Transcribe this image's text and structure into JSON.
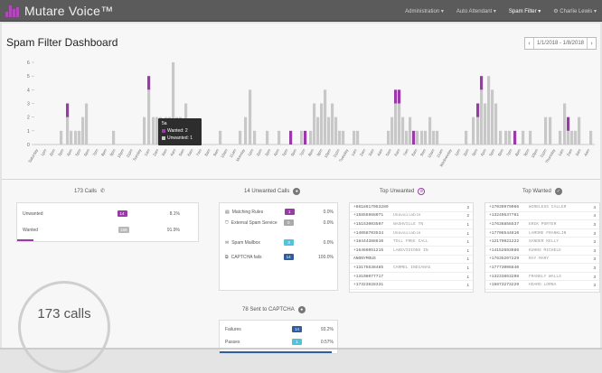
{
  "app": {
    "name": "Mutare Voice™"
  },
  "nav": [
    {
      "label": "Administration ▾",
      "active": false
    },
    {
      "label": "Auto Attendant ▾",
      "active": false
    },
    {
      "label": "Spam Filter ▾",
      "active": true
    },
    {
      "label": "⚙ Charlie Lewis ▾",
      "active": false
    }
  ],
  "page": {
    "title": "Spam Filter Dashboard"
  },
  "date_picker": {
    "prev": "‹",
    "label": "1/1/2018 - 1/8/2018",
    "next": "›"
  },
  "colors": {
    "accent": "#9a3aa8",
    "bar_gray": "#c8c8c8",
    "blue": "#2f5d9e",
    "cyan": "#53c3dc",
    "topbar": "#5b5b5b"
  },
  "chart_data": {
    "type": "bar",
    "stacked": true,
    "series": [
      {
        "name": "Wanted",
        "color": "#c8c8c8"
      },
      {
        "name": "Unwanted",
        "color": "#9a3aa8"
      }
    ],
    "y_ticks": [
      "0",
      "1",
      "2",
      "3",
      "4",
      "5",
      "6"
    ],
    "ylim": [
      0,
      6.2
    ],
    "x_tick_labels": [
      "Saturday",
      "1pm",
      "2pm",
      "3pm",
      "4pm",
      "5pm",
      "6pm",
      "7pm",
      "8pm",
      "9pm",
      "10pm",
      "11pm",
      "Sunday",
      "1am",
      "2am",
      "3am",
      "4am",
      "5am",
      "6am",
      "7am",
      "8am",
      "9am",
      "10am",
      "11am",
      "Monday",
      "1pm",
      "2pm",
      "3pm",
      "4pm",
      "5pm",
      "6pm",
      "7pm",
      "8pm",
      "9pm",
      "10pm",
      "11pm",
      "Tuesday",
      "1am",
      "2am",
      "3am",
      "4am",
      "5am",
      "6am",
      "7am",
      "8am",
      "9am",
      "10am",
      "11am",
      "Wednesday",
      "1pm",
      "2pm",
      "3pm",
      "4pm",
      "5pm",
      "6pm",
      "7pm",
      "8pm",
      "9pm",
      "10pm",
      "11pm",
      "Thursday",
      "1am",
      "2am",
      "3am",
      "4am"
    ],
    "bars": [
      {
        "x": 64,
        "wanted": 1,
        "unwanted": 0
      },
      {
        "x": 71,
        "wanted": 2,
        "unwanted": 1
      },
      {
        "x": 75,
        "wanted": 1,
        "unwanted": 0
      },
      {
        "x": 80,
        "wanted": 1,
        "unwanted": 0
      },
      {
        "x": 84,
        "wanted": 1,
        "unwanted": 0
      },
      {
        "x": 88,
        "wanted": 2,
        "unwanted": 0
      },
      {
        "x": 92,
        "wanted": 3,
        "unwanted": 0
      },
      {
        "x": 122,
        "wanted": 1,
        "unwanted": 0
      },
      {
        "x": 156,
        "wanted": 2,
        "unwanted": 0
      },
      {
        "x": 161,
        "wanted": 4,
        "unwanted": 1
      },
      {
        "x": 166,
        "wanted": 2,
        "unwanted": 0
      },
      {
        "x": 170,
        "wanted": 2,
        "unwanted": 0
      },
      {
        "x": 174,
        "wanted": 2,
        "unwanted": 0
      },
      {
        "x": 180,
        "wanted": 2,
        "unwanted": 0
      },
      {
        "x": 184,
        "wanted": 2,
        "unwanted": 0
      },
      {
        "x": 188,
        "wanted": 6,
        "unwanted": 0
      },
      {
        "x": 192,
        "wanted": 2,
        "unwanted": 0
      },
      {
        "x": 196,
        "wanted": 2,
        "unwanted": 0
      },
      {
        "x": 202,
        "wanted": 3,
        "unwanted": 0
      },
      {
        "x": 208,
        "wanted": 1,
        "unwanted": 0
      },
      {
        "x": 240,
        "wanted": 1,
        "unwanted": 0
      },
      {
        "x": 262,
        "wanted": 1,
        "unwanted": 0
      },
      {
        "x": 268,
        "wanted": 2,
        "unwanted": 0
      },
      {
        "x": 273,
        "wanted": 4,
        "unwanted": 0
      },
      {
        "x": 278,
        "wanted": 1,
        "unwanted": 0
      },
      {
        "x": 292,
        "wanted": 1,
        "unwanted": 0
      },
      {
        "x": 305,
        "wanted": 1,
        "unwanted": 0
      },
      {
        "x": 318,
        "wanted": 0,
        "unwanted": 1
      },
      {
        "x": 330,
        "wanted": 1,
        "unwanted": 0
      },
      {
        "x": 334,
        "wanted": 0,
        "unwanted": 1
      },
      {
        "x": 340,
        "wanted": 1,
        "unwanted": 0
      },
      {
        "x": 344,
        "wanted": 3,
        "unwanted": 0
      },
      {
        "x": 348,
        "wanted": 2,
        "unwanted": 0
      },
      {
        "x": 352,
        "wanted": 3,
        "unwanted": 0
      },
      {
        "x": 356,
        "wanted": 4,
        "unwanted": 0
      },
      {
        "x": 360,
        "wanted": 2,
        "unwanted": 0
      },
      {
        "x": 364,
        "wanted": 3,
        "unwanted": 0
      },
      {
        "x": 368,
        "wanted": 2,
        "unwanted": 0
      },
      {
        "x": 372,
        "wanted": 1,
        "unwanted": 0
      },
      {
        "x": 376,
        "wanted": 1,
        "unwanted": 0
      },
      {
        "x": 388,
        "wanted": 1,
        "unwanted": 0
      },
      {
        "x": 392,
        "wanted": 1,
        "unwanted": 0
      },
      {
        "x": 426,
        "wanted": 1,
        "unwanted": 0
      },
      {
        "x": 430,
        "wanted": 2,
        "unwanted": 0
      },
      {
        "x": 434,
        "wanted": 3,
        "unwanted": 1
      },
      {
        "x": 438,
        "wanted": 3,
        "unwanted": 1
      },
      {
        "x": 442,
        "wanted": 2,
        "unwanted": 0
      },
      {
        "x": 446,
        "wanted": 1,
        "unwanted": 0
      },
      {
        "x": 450,
        "wanted": 2,
        "unwanted": 0
      },
      {
        "x": 454,
        "wanted": 0,
        "unwanted": 1
      },
      {
        "x": 458,
        "wanted": 1,
        "unwanted": 0
      },
      {
        "x": 463,
        "wanted": 1,
        "unwanted": 0
      },
      {
        "x": 467,
        "wanted": 1,
        "unwanted": 0
      },
      {
        "x": 472,
        "wanted": 2,
        "unwanted": 0
      },
      {
        "x": 476,
        "wanted": 1,
        "unwanted": 0
      },
      {
        "x": 480,
        "wanted": 1,
        "unwanted": 0
      },
      {
        "x": 512,
        "wanted": 1,
        "unwanted": 0
      },
      {
        "x": 520,
        "wanted": 2,
        "unwanted": 0
      },
      {
        "x": 525,
        "wanted": 2,
        "unwanted": 1
      },
      {
        "x": 529,
        "wanted": 4,
        "unwanted": 1
      },
      {
        "x": 533,
        "wanted": 3,
        "unwanted": 0
      },
      {
        "x": 537,
        "wanted": 5,
        "unwanted": 0
      },
      {
        "x": 541,
        "wanted": 4,
        "unwanted": 0
      },
      {
        "x": 545,
        "wanted": 3,
        "unwanted": 0
      },
      {
        "x": 550,
        "wanted": 1,
        "unwanted": 0
      },
      {
        "x": 556,
        "wanted": 1,
        "unwanted": 0
      },
      {
        "x": 560,
        "wanted": 1,
        "unwanted": 0
      },
      {
        "x": 566,
        "wanted": 0,
        "unwanted": 1
      },
      {
        "x": 575,
        "wanted": 1,
        "unwanted": 0
      },
      {
        "x": 583,
        "wanted": 1,
        "unwanted": 0
      },
      {
        "x": 600,
        "wanted": 2,
        "unwanted": 0
      },
      {
        "x": 605,
        "wanted": 2,
        "unwanted": 0
      },
      {
        "x": 616,
        "wanted": 1,
        "unwanted": 0
      },
      {
        "x": 621,
        "wanted": 3,
        "unwanted": 0
      },
      {
        "x": 625,
        "wanted": 1,
        "unwanted": 1
      },
      {
        "x": 629,
        "wanted": 1,
        "unwanted": 0
      },
      {
        "x": 633,
        "wanted": 1,
        "unwanted": 0
      },
      {
        "x": 637,
        "wanted": 2,
        "unwanted": 0
      },
      {
        "x": 650,
        "wanted": 1,
        "unwanted": 0
      }
    ],
    "tooltip": {
      "title": "5a",
      "lines": [
        "Wanted: 2",
        "Unwanted: 1"
      ]
    }
  },
  "panels": {
    "calls": {
      "title": "173 Calls",
      "icon": "phone-icon",
      "rows": [
        {
          "label": "Unwanted",
          "count": "14",
          "pct": "8.1%",
          "color": "#9a3aa8"
        },
        {
          "label": "Wanted",
          "count": "159",
          "pct": "91.9%",
          "color": "#b8b8b8"
        }
      ],
      "donut_label": "173 calls"
    },
    "unwanted": {
      "title": "14 Unwanted Calls",
      "rows": [
        {
          "icon": "list-icon",
          "label": "Matching Rules",
          "count": "1",
          "pct": "0.0%",
          "color": "#9a3aa8"
        },
        {
          "icon": "shield-icon",
          "label": "External Spam Service",
          "count": "0",
          "pct": "0.0%",
          "color": "#aaaaaa"
        },
        {
          "icon": "mail-icon",
          "label": "Spam Mailbox",
          "count": "0",
          "pct": "0.0%",
          "color": "#53c3dc"
        },
        {
          "icon": "captcha-icon",
          "label": "CAPTCHA fails",
          "count": "14",
          "pct": "100.0%",
          "color": "#2f5d9e"
        }
      ],
      "captcha_title": "78 Sent to CAPTCHA",
      "captcha_rows": [
        {
          "label": "Failures",
          "count": "14",
          "pct": "93.2%",
          "color": "#2f5d9e"
        },
        {
          "label": "Passes",
          "count": "1",
          "pct": "0.57%",
          "color": "#53c3dc"
        }
      ]
    },
    "top_unwanted": {
      "title": "Top Unwanted",
      "items": [
        {
          "num": "+8618617053289",
          "name": "",
          "count": "2"
        },
        {
          "num": "+15855968071",
          "name": "Unavailable",
          "count": "2"
        },
        {
          "num": "+15153003507",
          "name": "NASHVILLE TN",
          "count": "1"
        },
        {
          "num": "+14058703534",
          "name": "Unavailable",
          "count": "1"
        },
        {
          "num": "+18444388610",
          "name": "TOLL FREE CALL",
          "count": "1"
        },
        {
          "num": "+16466051215",
          "name": "LAKEVISIONS IN",
          "count": "1"
        },
        {
          "num": "ANONYMOUS",
          "name": "",
          "count": "1"
        },
        {
          "num": "+13175538485",
          "name": "CARMEL INDIANAG",
          "count": "1"
        },
        {
          "num": "+13108077717",
          "name": "",
          "count": "1"
        },
        {
          "num": "+17323828331",
          "name": "",
          "count": "1"
        }
      ]
    },
    "top_wanted": {
      "title": "Top Wanted",
      "items": [
        {
          "num": "+17039979066",
          "name": "WIRELESS CALLER",
          "count": "4"
        },
        {
          "num": "+13240537761",
          "name": "",
          "count": "4"
        },
        {
          "num": "+17636856537",
          "name": "ERIK PORTER",
          "count": "3"
        },
        {
          "num": "+17706544810",
          "name": "LAMORE FRANKLIN",
          "count": "3"
        },
        {
          "num": "+12179021222",
          "name": "SANDER KELLY",
          "count": "3"
        },
        {
          "num": "+14152693686",
          "name": "KUHNS MICHELE",
          "count": "3"
        },
        {
          "num": "+17635207229",
          "name": "RAY MARY",
          "count": "3"
        },
        {
          "num": "+17773006840",
          "name": "",
          "count": "3"
        },
        {
          "num": "+13233863208",
          "name": "FRANKLY WALLS",
          "count": "3"
        },
        {
          "num": "+16873273229",
          "name": "HOARD LORNA",
          "count": "3"
        }
      ]
    }
  }
}
